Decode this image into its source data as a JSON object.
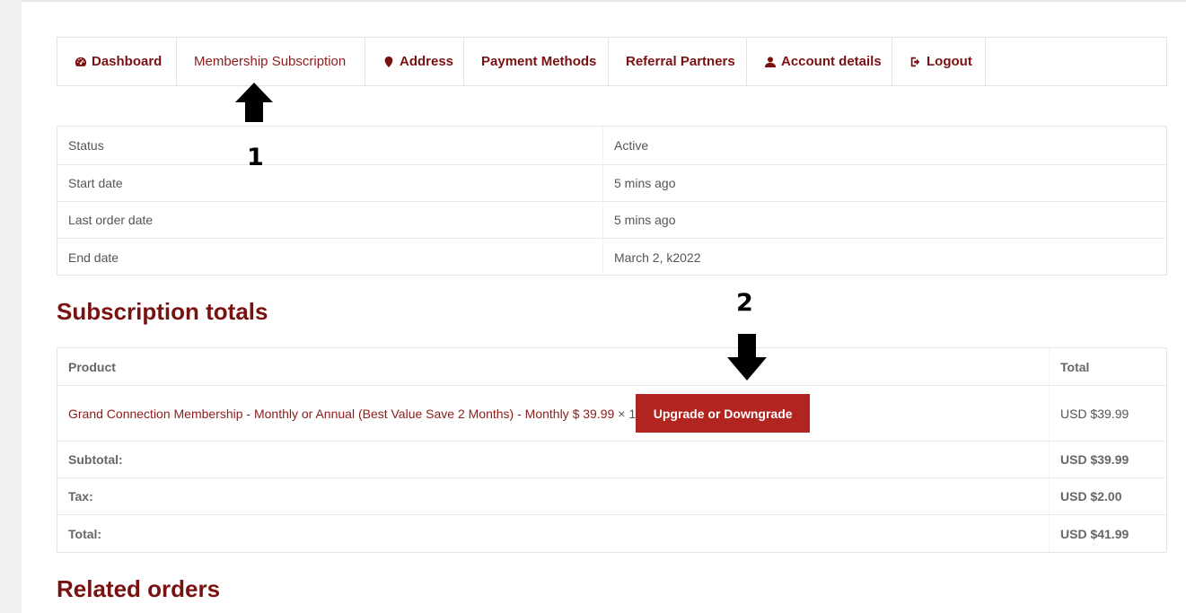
{
  "nav": {
    "items": [
      {
        "label": "Dashboard",
        "icon": "dashboard-icon"
      },
      {
        "label": "Membership Subscription",
        "icon": ""
      },
      {
        "label": "Address",
        "icon": "map-marker-icon"
      },
      {
        "label": "Payment Methods",
        "icon": ""
      },
      {
        "label": "Referral Partners",
        "icon": ""
      },
      {
        "label": "Account details",
        "icon": "user-icon"
      },
      {
        "label": "Logout",
        "icon": "sign-out-icon"
      }
    ]
  },
  "subscription": {
    "rows": [
      {
        "label": "Status",
        "value": "Active"
      },
      {
        "label": "Start date",
        "value": "5 mins ago"
      },
      {
        "label": "Last order date",
        "value": "5 mins ago"
      },
      {
        "label": "End date",
        "value": "March 2, k2022"
      }
    ]
  },
  "totals": {
    "title": "Subscription totals",
    "header": {
      "product": "Product",
      "total": "Total"
    },
    "product": {
      "name": "Grand Connection Membership - Monthly or Annual (Best Value Save 2 Months) - Monthly $ 39.99",
      "qty": "× 1",
      "button": "Upgrade or Downgrade",
      "total": "USD $39.99"
    },
    "subtotal": {
      "label": "Subtotal:",
      "value": "USD $39.99"
    },
    "tax": {
      "label": "Tax:",
      "value": "USD $2.00"
    },
    "total": {
      "label": "Total:",
      "value": "USD $41.99"
    }
  },
  "related": {
    "title": "Related orders"
  },
  "annotations": {
    "one": "1",
    "two": "2"
  },
  "colors": {
    "accent": "#7a1111",
    "button": "#b2241f"
  }
}
